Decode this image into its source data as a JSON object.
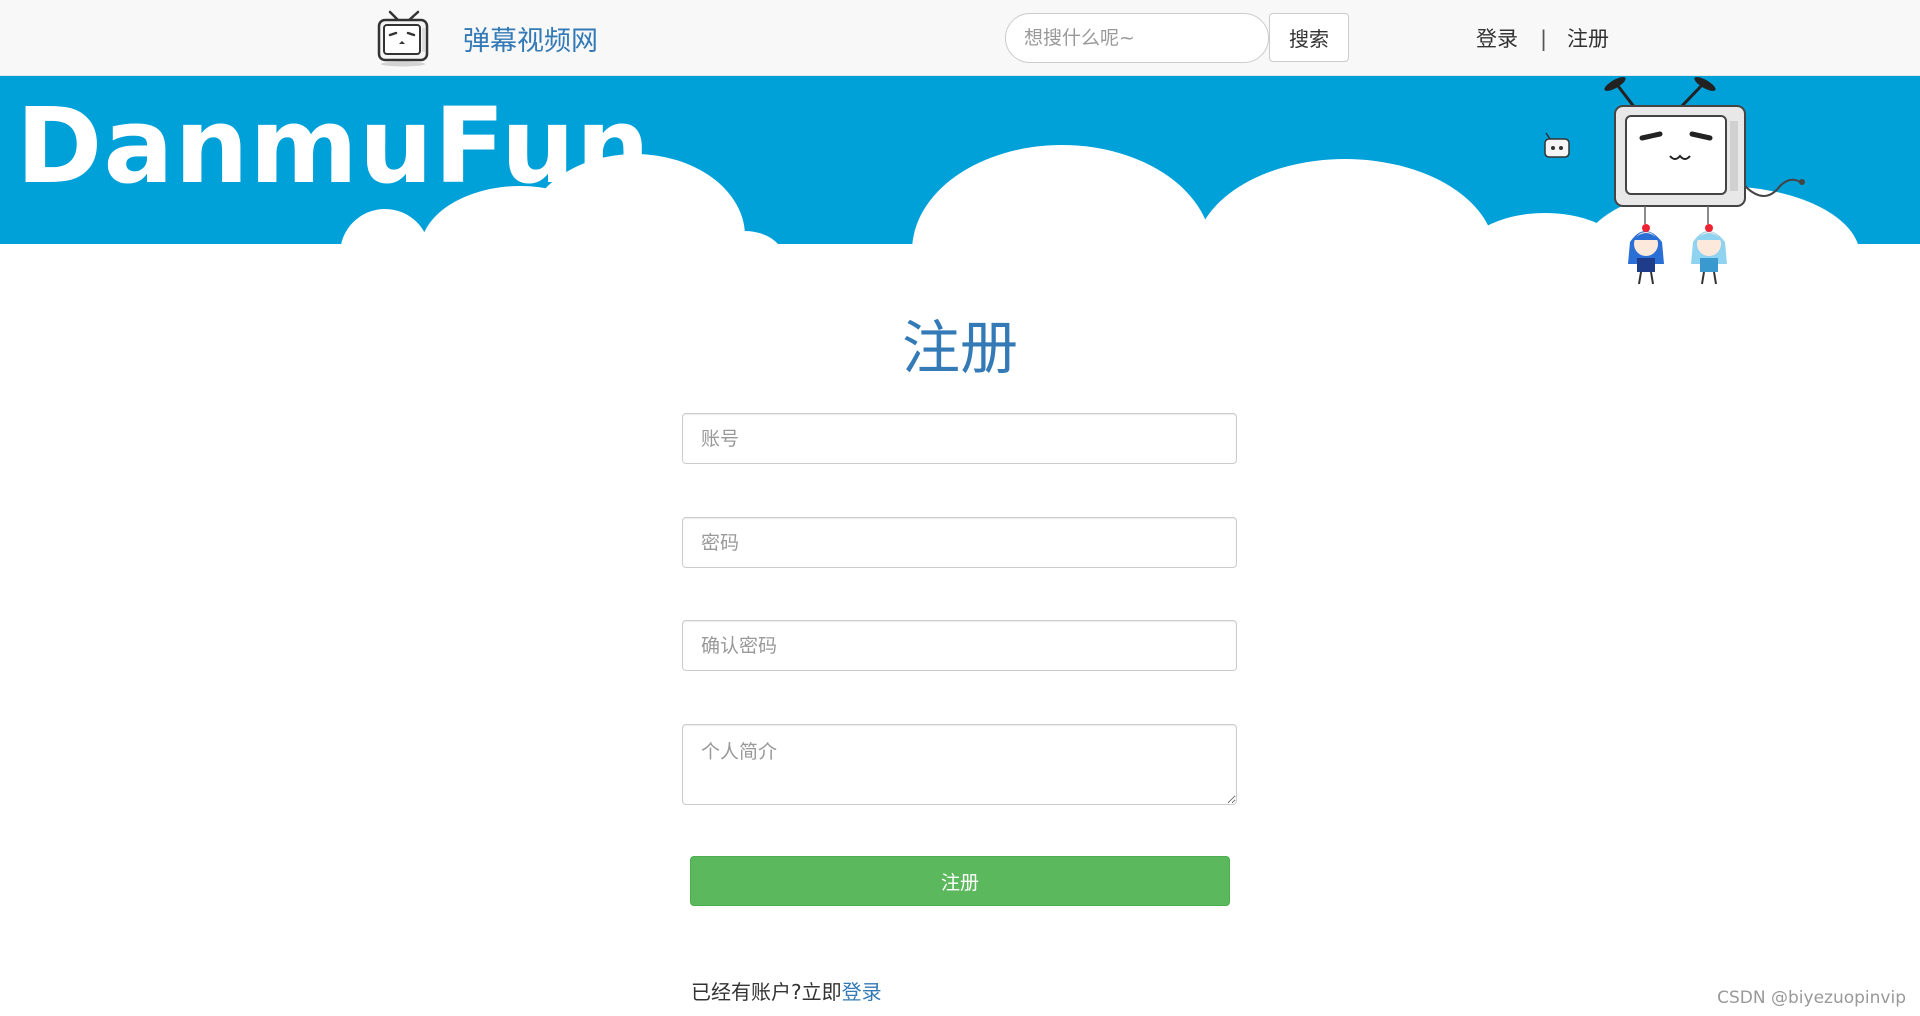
{
  "navbar": {
    "brand_name": "弹幕视频网",
    "search_placeholder": "想搜什么呢~",
    "search_button": "搜索",
    "login": "登录",
    "separator": "|",
    "register": "注册"
  },
  "banner": {
    "title": "DanmuFun",
    "sky_color": "#00a0d9"
  },
  "form": {
    "title": "注册",
    "account_placeholder": "账号",
    "password_placeholder": "密码",
    "confirm_placeholder": "确认密码",
    "bio_placeholder": "个人简介",
    "submit_label": "注册",
    "login_prompt": "已经有账户?立即",
    "login_link": "登录"
  },
  "watermark": "CSDN @biyezuopinvip",
  "colors": {
    "link_blue": "#337ab7",
    "success_green": "#5cb85c"
  }
}
